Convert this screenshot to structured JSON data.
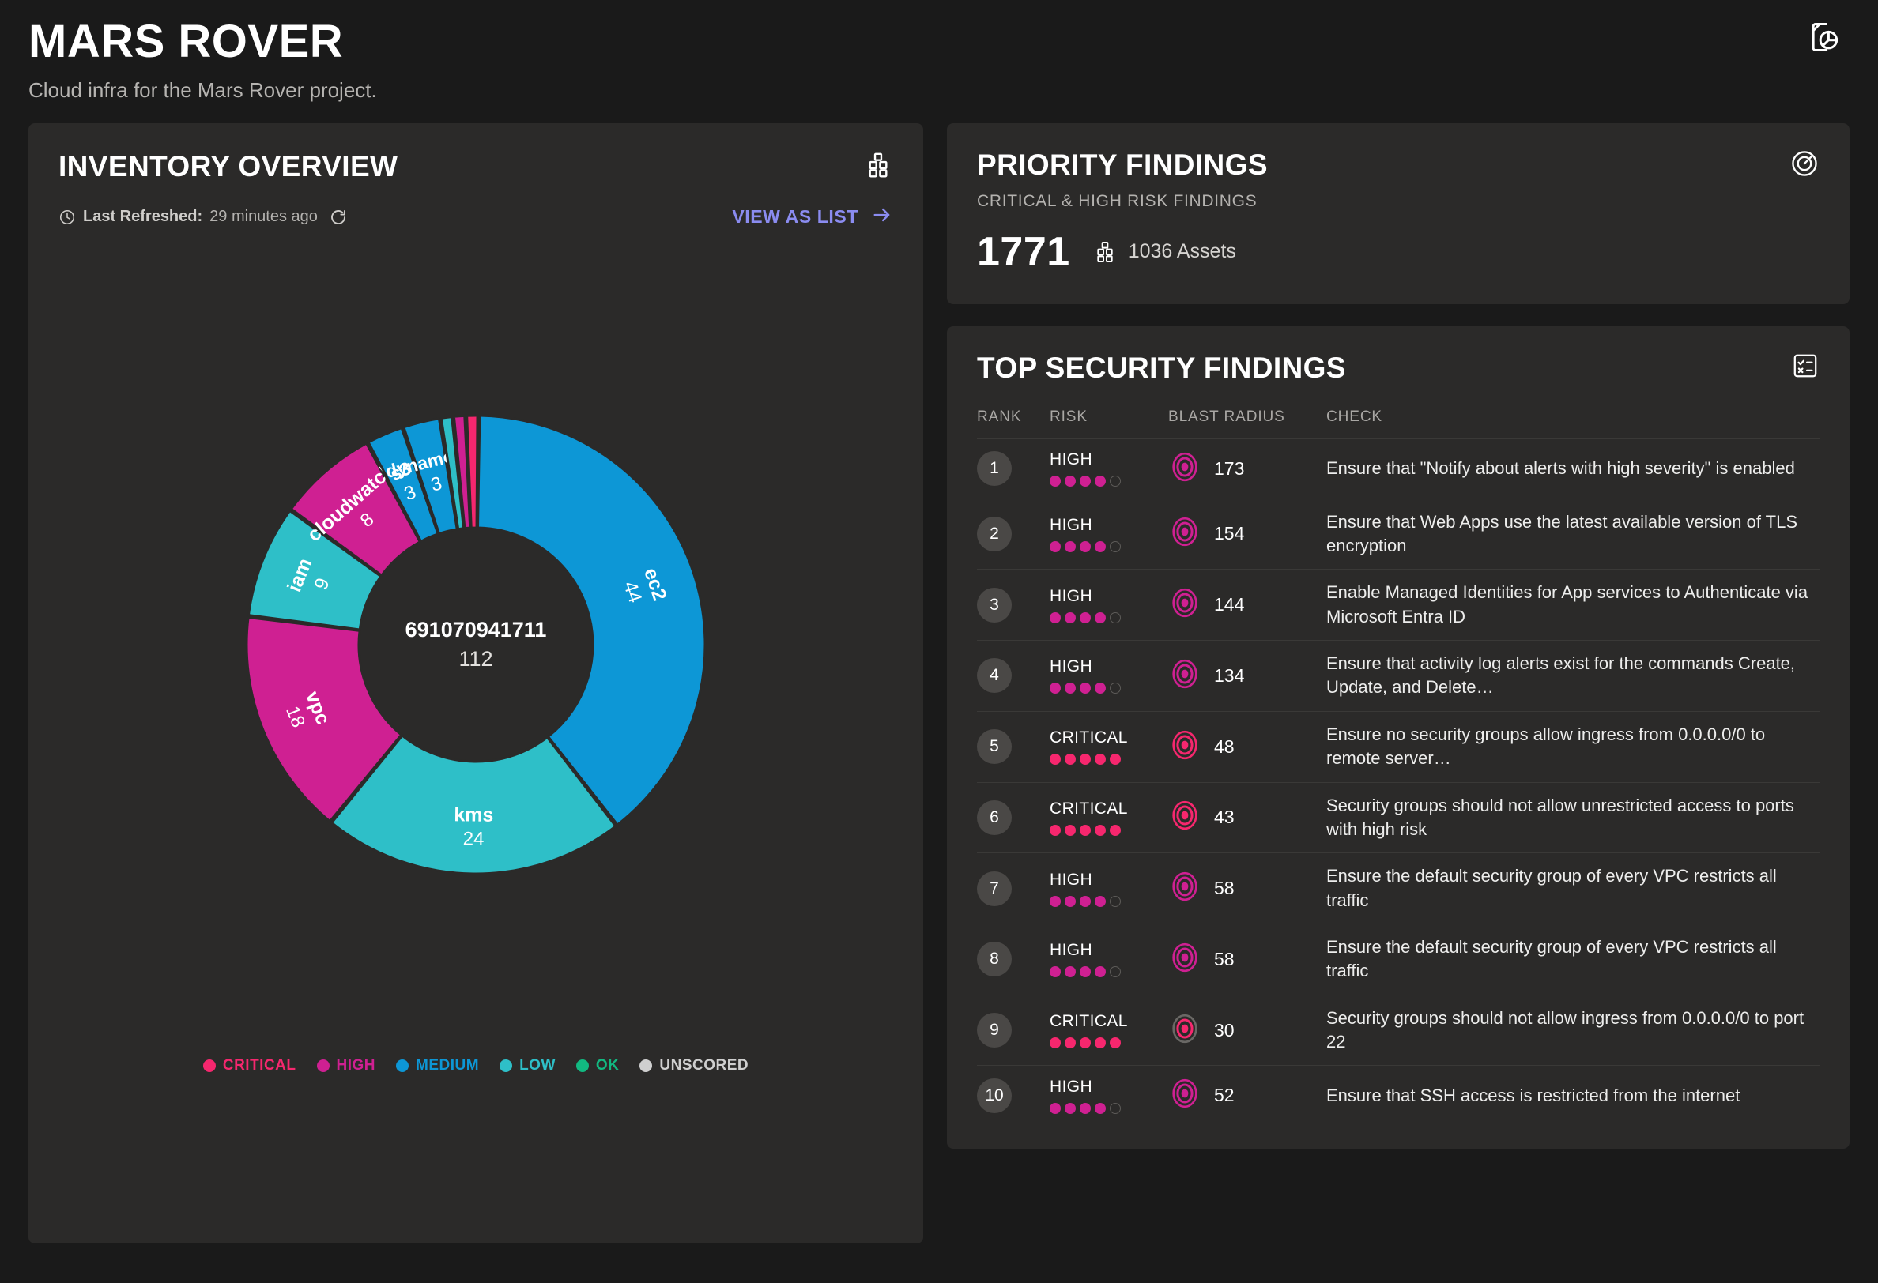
{
  "header": {
    "title": "MARS ROVER",
    "subtitle": "Cloud infra for the Mars Rover project.",
    "action_icon": "report-document-pie-icon"
  },
  "inventory": {
    "title": "INVENTORY OVERVIEW",
    "icon": "inventory-blocks-icon",
    "refresh_label": "Last Refreshed:",
    "refresh_value": "29 minutes ago",
    "refresh_icon": "refresh-icon",
    "clock_icon": "clock-icon",
    "view_as_list": "VIEW AS LIST",
    "arrow_icon": "arrow-right-icon",
    "center_id": "691070941711",
    "center_count": "112",
    "legend": [
      {
        "label": "CRITICAL",
        "color": "#f6276e"
      },
      {
        "label": "HIGH",
        "color": "#cf2092"
      },
      {
        "label": "MEDIUM",
        "color": "#0d97d6"
      },
      {
        "label": "LOW",
        "color": "#2ebfc8"
      },
      {
        "label": "OK",
        "color": "#12b981"
      },
      {
        "label": "UNSCORED",
        "color": "#cfcfcf"
      }
    ]
  },
  "chart_data": {
    "type": "pie",
    "title": "INVENTORY OVERVIEW",
    "subtitle": "691070941711",
    "total": 112,
    "center_label": "691070941711",
    "center_value": "112",
    "legend_position": "bottom",
    "categories": [
      "ec2",
      "kms",
      "vpc",
      "iam",
      "cloudwatch",
      "s3",
      "dynamodb",
      "low-sliver",
      "high-sliver",
      "critical-sliver"
    ],
    "values": [
      44,
      24,
      18,
      9,
      8,
      3,
      3,
      1,
      1,
      1
    ],
    "slices": [
      {
        "label": "ec2",
        "value": 44,
        "severity": "MEDIUM",
        "color": "#0d97d6",
        "show_label": true
      },
      {
        "label": "kms",
        "value": 24,
        "severity": "LOW",
        "color": "#2ebfc8",
        "show_label": true
      },
      {
        "label": "vpc",
        "value": 18,
        "severity": "HIGH",
        "color": "#cf2092",
        "show_label": true
      },
      {
        "label": "iam",
        "value": 9,
        "severity": "LOW",
        "color": "#2ebfc8",
        "show_label": true
      },
      {
        "label": "cloudwatch",
        "value": 8,
        "severity": "HIGH",
        "color": "#cf2092",
        "show_label": true
      },
      {
        "label": "s3",
        "value": 3,
        "severity": "MEDIUM",
        "color": "#0d97d6",
        "show_label": true
      },
      {
        "label": "dynamodb",
        "value": 3,
        "severity": "MEDIUM",
        "color": "#0d97d6",
        "show_label": true
      },
      {
        "label": "",
        "value": 1,
        "severity": "LOW",
        "color": "#2ebfc8",
        "show_label": false
      },
      {
        "label": "",
        "value": 1,
        "severity": "HIGH",
        "color": "#cf2092",
        "show_label": false
      },
      {
        "label": "",
        "value": 1,
        "severity": "CRITICAL",
        "color": "#f6276e",
        "show_label": false
      }
    ]
  },
  "priority_findings": {
    "title": "PRIORITY FINDINGS",
    "subtitle": "CRITICAL & HIGH RISK FINDINGS",
    "icon": "radar-target-icon",
    "count": "1771",
    "assets_icon": "inventory-blocks-icon",
    "assets_text": "1036 Assets"
  },
  "top_findings": {
    "title": "TOP SECURITY FINDINGS",
    "icon": "checklist-icon",
    "columns": [
      "RANK",
      "RISK",
      "BLAST RADIUS",
      "CHECK"
    ],
    "rows": [
      {
        "rank": "1",
        "risk": "HIGH",
        "dots": 4,
        "blast": "173",
        "check": "Ensure that \"Notify about alerts with high severity\" is enabled"
      },
      {
        "rank": "2",
        "risk": "HIGH",
        "dots": 4,
        "blast": "154",
        "check": "Ensure that Web Apps use the latest available version of TLS encryption"
      },
      {
        "rank": "3",
        "risk": "HIGH",
        "dots": 4,
        "blast": "144",
        "check": "Enable Managed Identities for App services to Authenticate via Microsoft Entra ID"
      },
      {
        "rank": "4",
        "risk": "HIGH",
        "dots": 4,
        "blast": "134",
        "check": "Ensure that activity log alerts exist for the commands Create, Update, and Delete…"
      },
      {
        "rank": "5",
        "risk": "CRITICAL",
        "dots": 5,
        "blast": "48",
        "check": "Ensure no security groups allow ingress from 0.0.0.0/0 to remote server…"
      },
      {
        "rank": "6",
        "risk": "CRITICAL",
        "dots": 5,
        "blast": "43",
        "check": "Security groups should not allow unrestricted access to ports with high risk"
      },
      {
        "rank": "7",
        "risk": "HIGH",
        "dots": 4,
        "blast": "58",
        "check": "Ensure the default security group of every VPC restricts all traffic"
      },
      {
        "rank": "8",
        "risk": "HIGH",
        "dots": 4,
        "blast": "58",
        "check": "Ensure the default security group of every VPC restricts all traffic"
      },
      {
        "rank": "9",
        "risk": "CRITICAL",
        "dots": 5,
        "blast": "30",
        "check": "Security groups should not allow ingress from 0.0.0.0/0 to port 22"
      },
      {
        "rank": "10",
        "risk": "HIGH",
        "dots": 4,
        "blast": "52",
        "check": "Ensure that SSH access is restricted from the internet"
      }
    ]
  },
  "colors": {
    "critical": "#f6276e",
    "high": "#cf2092",
    "medium": "#0d97d6",
    "low": "#2ebfc8",
    "ok": "#12b981",
    "unscored": "#cfcfcf",
    "accent_link": "#8b8cf0",
    "page_bg": "#1a1a1a",
    "card_bg": "#2b2a29"
  }
}
